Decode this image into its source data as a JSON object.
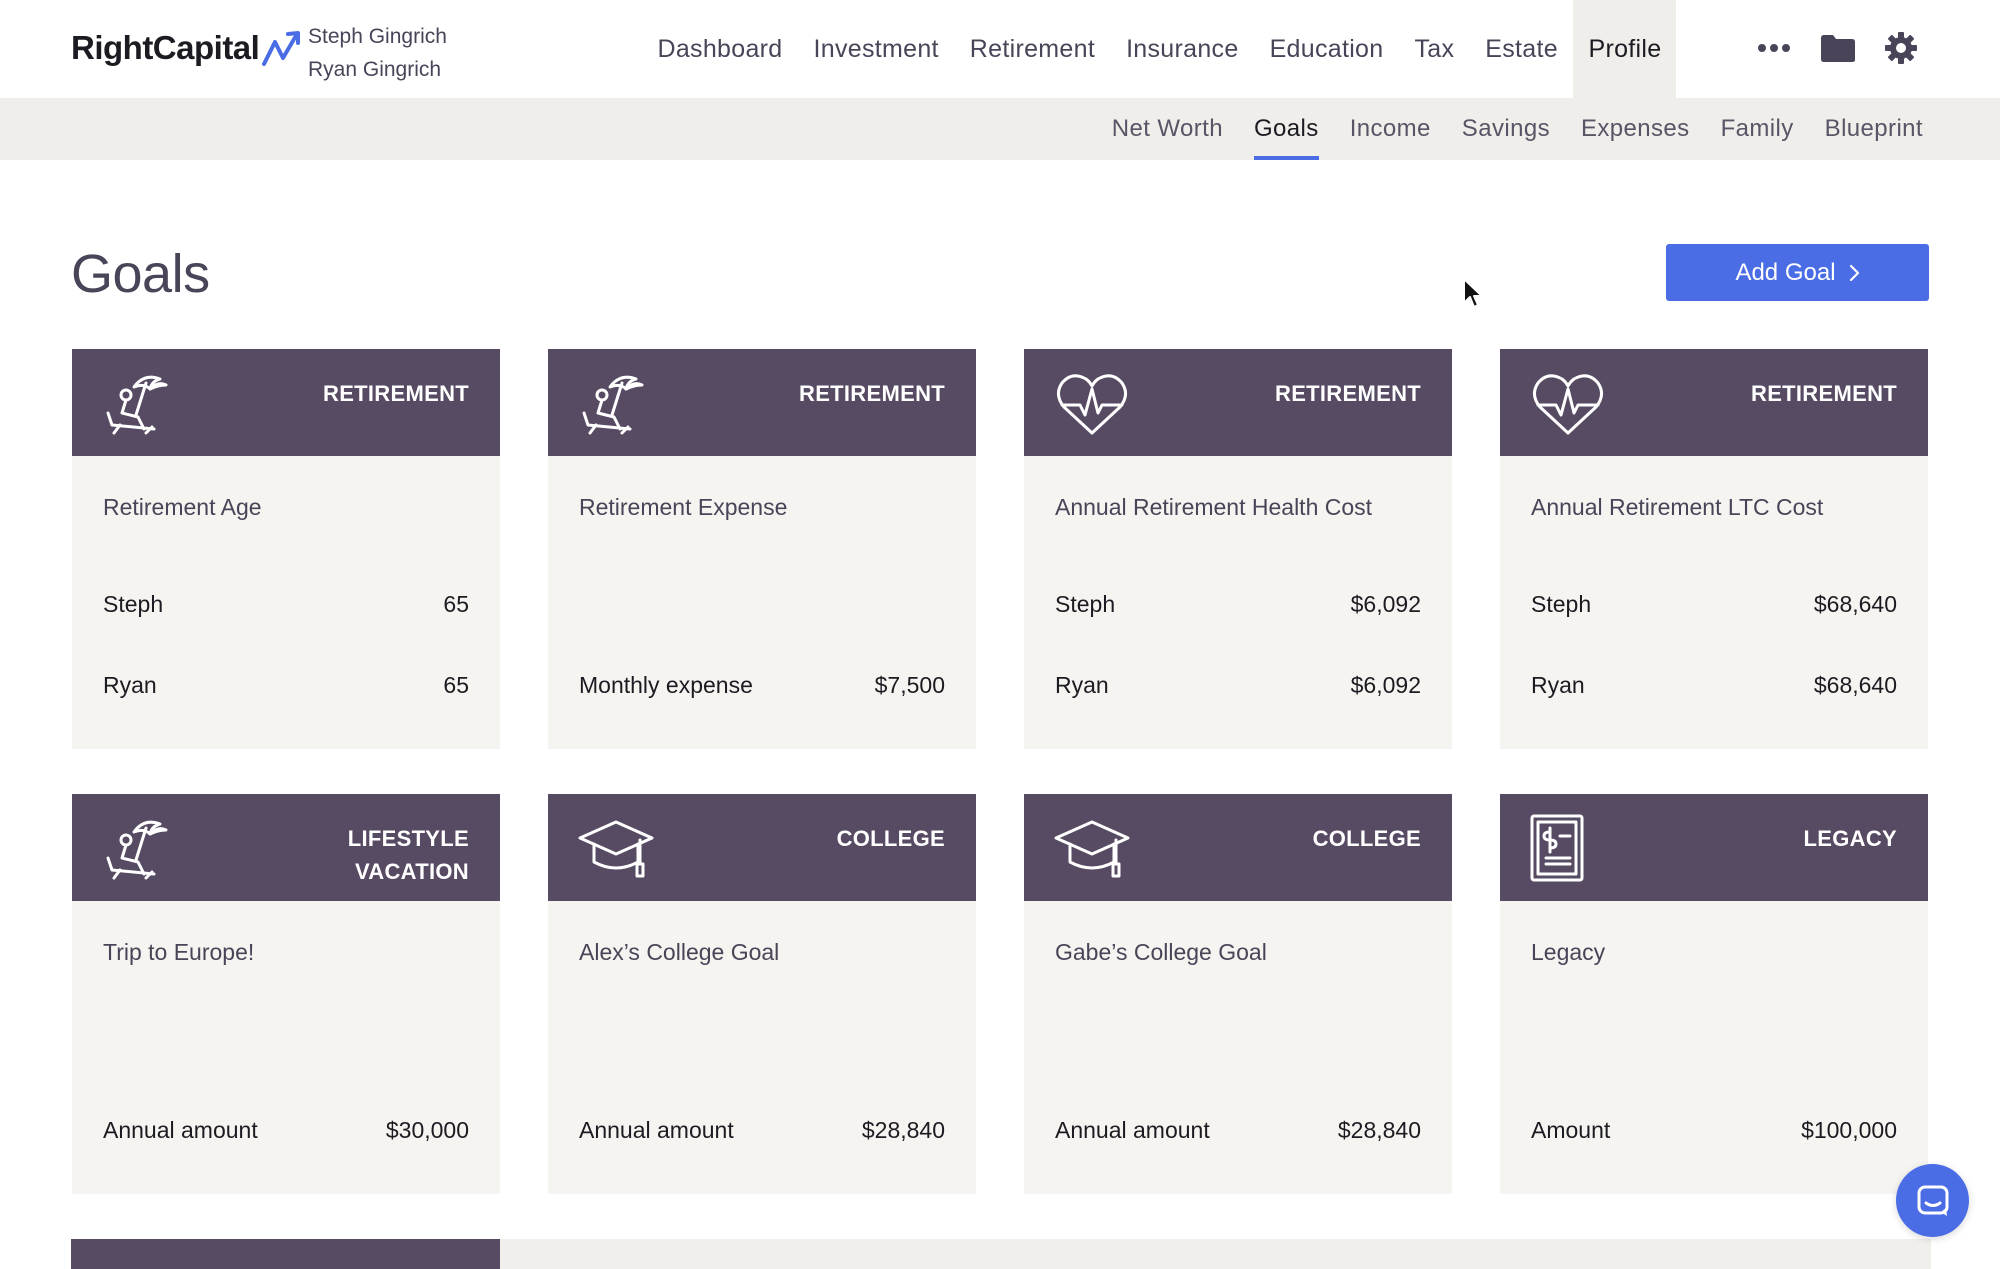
{
  "brand": {
    "name": "RightCapital",
    "household": [
      "Steph Gingrich",
      "Ryan Gingrich"
    ]
  },
  "main_nav": [
    {
      "label": "Dashboard",
      "active": false
    },
    {
      "label": "Investment",
      "active": false
    },
    {
      "label": "Retirement",
      "active": false
    },
    {
      "label": "Insurance",
      "active": false
    },
    {
      "label": "Education",
      "active": false
    },
    {
      "label": "Tax",
      "active": false
    },
    {
      "label": "Estate",
      "active": false
    },
    {
      "label": "Profile",
      "active": true
    }
  ],
  "header_icons": [
    "more-icon",
    "folder-icon",
    "gear-icon"
  ],
  "sub_nav": [
    {
      "label": "Net Worth",
      "active": false
    },
    {
      "label": "Goals",
      "active": true
    },
    {
      "label": "Income",
      "active": false
    },
    {
      "label": "Savings",
      "active": false
    },
    {
      "label": "Expenses",
      "active": false
    },
    {
      "label": "Family",
      "active": false
    },
    {
      "label": "Blueprint",
      "active": false
    }
  ],
  "page": {
    "title": "Goals",
    "add_button": "Add Goal"
  },
  "colors": {
    "accent": "#4a6de5",
    "card_header": "#574b64",
    "card_body": "#f6f4f0",
    "subnav_bg": "#efeeea"
  },
  "cards": [
    {
      "icon": "beach-chair-icon",
      "category": "RETIREMENT",
      "title": "Retirement Age",
      "rows": [
        {
          "label": "Steph",
          "value": "65"
        },
        {
          "label": "Ryan",
          "value": "65"
        }
      ]
    },
    {
      "icon": "beach-chair-icon",
      "category": "RETIREMENT",
      "title": "Retirement Expense",
      "rows": [
        {
          "label": "Monthly expense",
          "value": "$7,500"
        }
      ]
    },
    {
      "icon": "heart-pulse-icon",
      "category": "RETIREMENT",
      "title": "Annual Retirement Health Cost",
      "rows": [
        {
          "label": "Steph",
          "value": "$6,092"
        },
        {
          "label": "Ryan",
          "value": "$6,092"
        }
      ]
    },
    {
      "icon": "heart-pulse-icon",
      "category": "RETIREMENT",
      "title": "Annual Retirement LTC Cost",
      "rows": [
        {
          "label": "Steph",
          "value": "$68,640"
        },
        {
          "label": "Ryan",
          "value": "$68,640"
        }
      ]
    },
    {
      "icon": "beach-chair-icon",
      "category": "LIFESTYLE VACATION",
      "title": "Trip to Europe!",
      "rows": [
        {
          "label": "Annual amount",
          "value": "$30,000"
        }
      ]
    },
    {
      "icon": "graduation-cap-icon",
      "category": "COLLEGE",
      "title": "Alex’s College Goal",
      "rows": [
        {
          "label": "Annual amount",
          "value": "$28,840"
        }
      ]
    },
    {
      "icon": "graduation-cap-icon",
      "category": "COLLEGE",
      "title": "Gabe’s College Goal",
      "rows": [
        {
          "label": "Annual amount",
          "value": "$28,840"
        }
      ]
    },
    {
      "icon": "document-dollar-icon",
      "category": "LEGACY",
      "title": "Legacy",
      "rows": [
        {
          "label": "Amount",
          "value": "$100,000"
        }
      ]
    }
  ]
}
